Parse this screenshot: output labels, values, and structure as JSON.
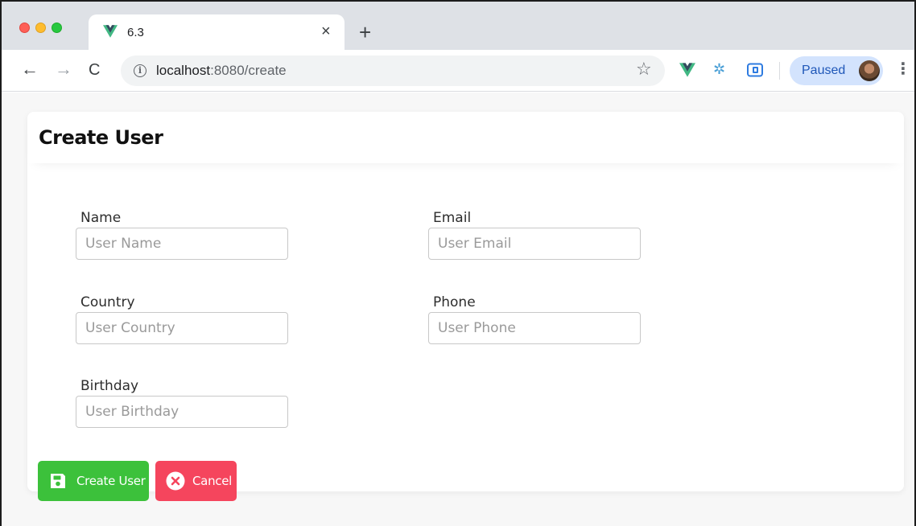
{
  "browser": {
    "tab_title": "6.3",
    "tab_close": "×",
    "new_tab": "+",
    "url_host": "localhost",
    "url_path": ":8080/create",
    "profile_label": "Paused",
    "nav": {
      "back": "←",
      "forward": "→",
      "reload": "C"
    },
    "star": "☆",
    "menu": "⋮",
    "info": "i",
    "bug_ext": "✲"
  },
  "page": {
    "title": "Create User",
    "fields": {
      "name": {
        "label": "Name",
        "placeholder": "User Name"
      },
      "email": {
        "label": "Email",
        "placeholder": "User Email"
      },
      "country": {
        "label": "Country",
        "placeholder": "User Country"
      },
      "phone": {
        "label": "Phone",
        "placeholder": "User Phone"
      },
      "birthday": {
        "label": "Birthday",
        "placeholder": "User Birthday"
      }
    },
    "buttons": {
      "create": "Create User",
      "cancel": "Cancel"
    }
  },
  "colors": {
    "create_button": "#3cc13b",
    "cancel_button": "#f5455d",
    "vue_green": "#41b883",
    "vue_dark": "#34495e",
    "paused_bg": "#d3e3fd"
  },
  "icons": {
    "create": "floppy-disk-icon",
    "cancel": "close-circle-icon"
  }
}
